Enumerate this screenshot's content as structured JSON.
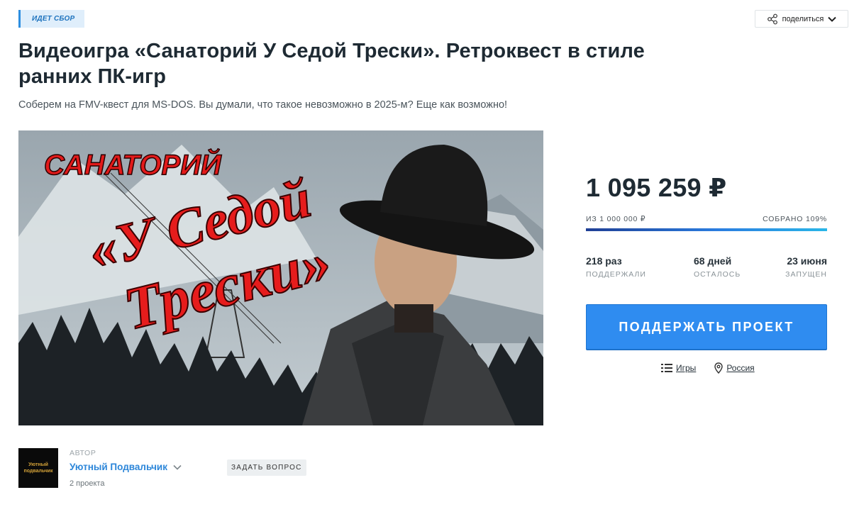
{
  "badge": "ИДЕТ СБОР",
  "share": {
    "label": "поделиться"
  },
  "project": {
    "title": "Видеоигра «Санаторий У Седой Трески». Ретроквест в стиле ранних ПК-игр",
    "subtitle": "Соберем на FMV-квест для MS-DOS. Вы думали, что такое невозможно в 2025-м? Еще как возможно!"
  },
  "cover": {
    "title_line1": "САНАТОРИЙ",
    "title_line2": "«У Седой",
    "title_line3": "Трески»"
  },
  "funding": {
    "amount": "1 095 259 ₽",
    "goal": "ИЗ 1 000 000 ₽",
    "collected": "СОБРАНО 109%",
    "progress_fraction": 1.0,
    "colors": {
      "start": "#1f3f95",
      "end": "#29b6e8"
    }
  },
  "stats": [
    {
      "value": "218 раз",
      "label": "ПОДДЕРЖАЛИ"
    },
    {
      "value": "68 дней",
      "label": "ОСТАЛОСЬ"
    },
    {
      "value": "23 июня",
      "label": "ЗАПУЩЕН"
    }
  ],
  "support_button": {
    "label": "ПОДДЕРЖАТЬ ПРОЕКТ",
    "color": "#2f8cf0"
  },
  "meta": {
    "category": {
      "label": "Игры",
      "icon": "list-icon"
    },
    "location": {
      "label": "Россия",
      "icon": "map-pin-icon"
    }
  },
  "author": {
    "label": "АВТОР",
    "name": "Уютный Подвальчик",
    "projects": "2 проекта",
    "avatar_line1": "Уютный",
    "avatar_line2": "подвальчик",
    "ask_label": "ЗАДАТЬ ВОПРОС"
  }
}
